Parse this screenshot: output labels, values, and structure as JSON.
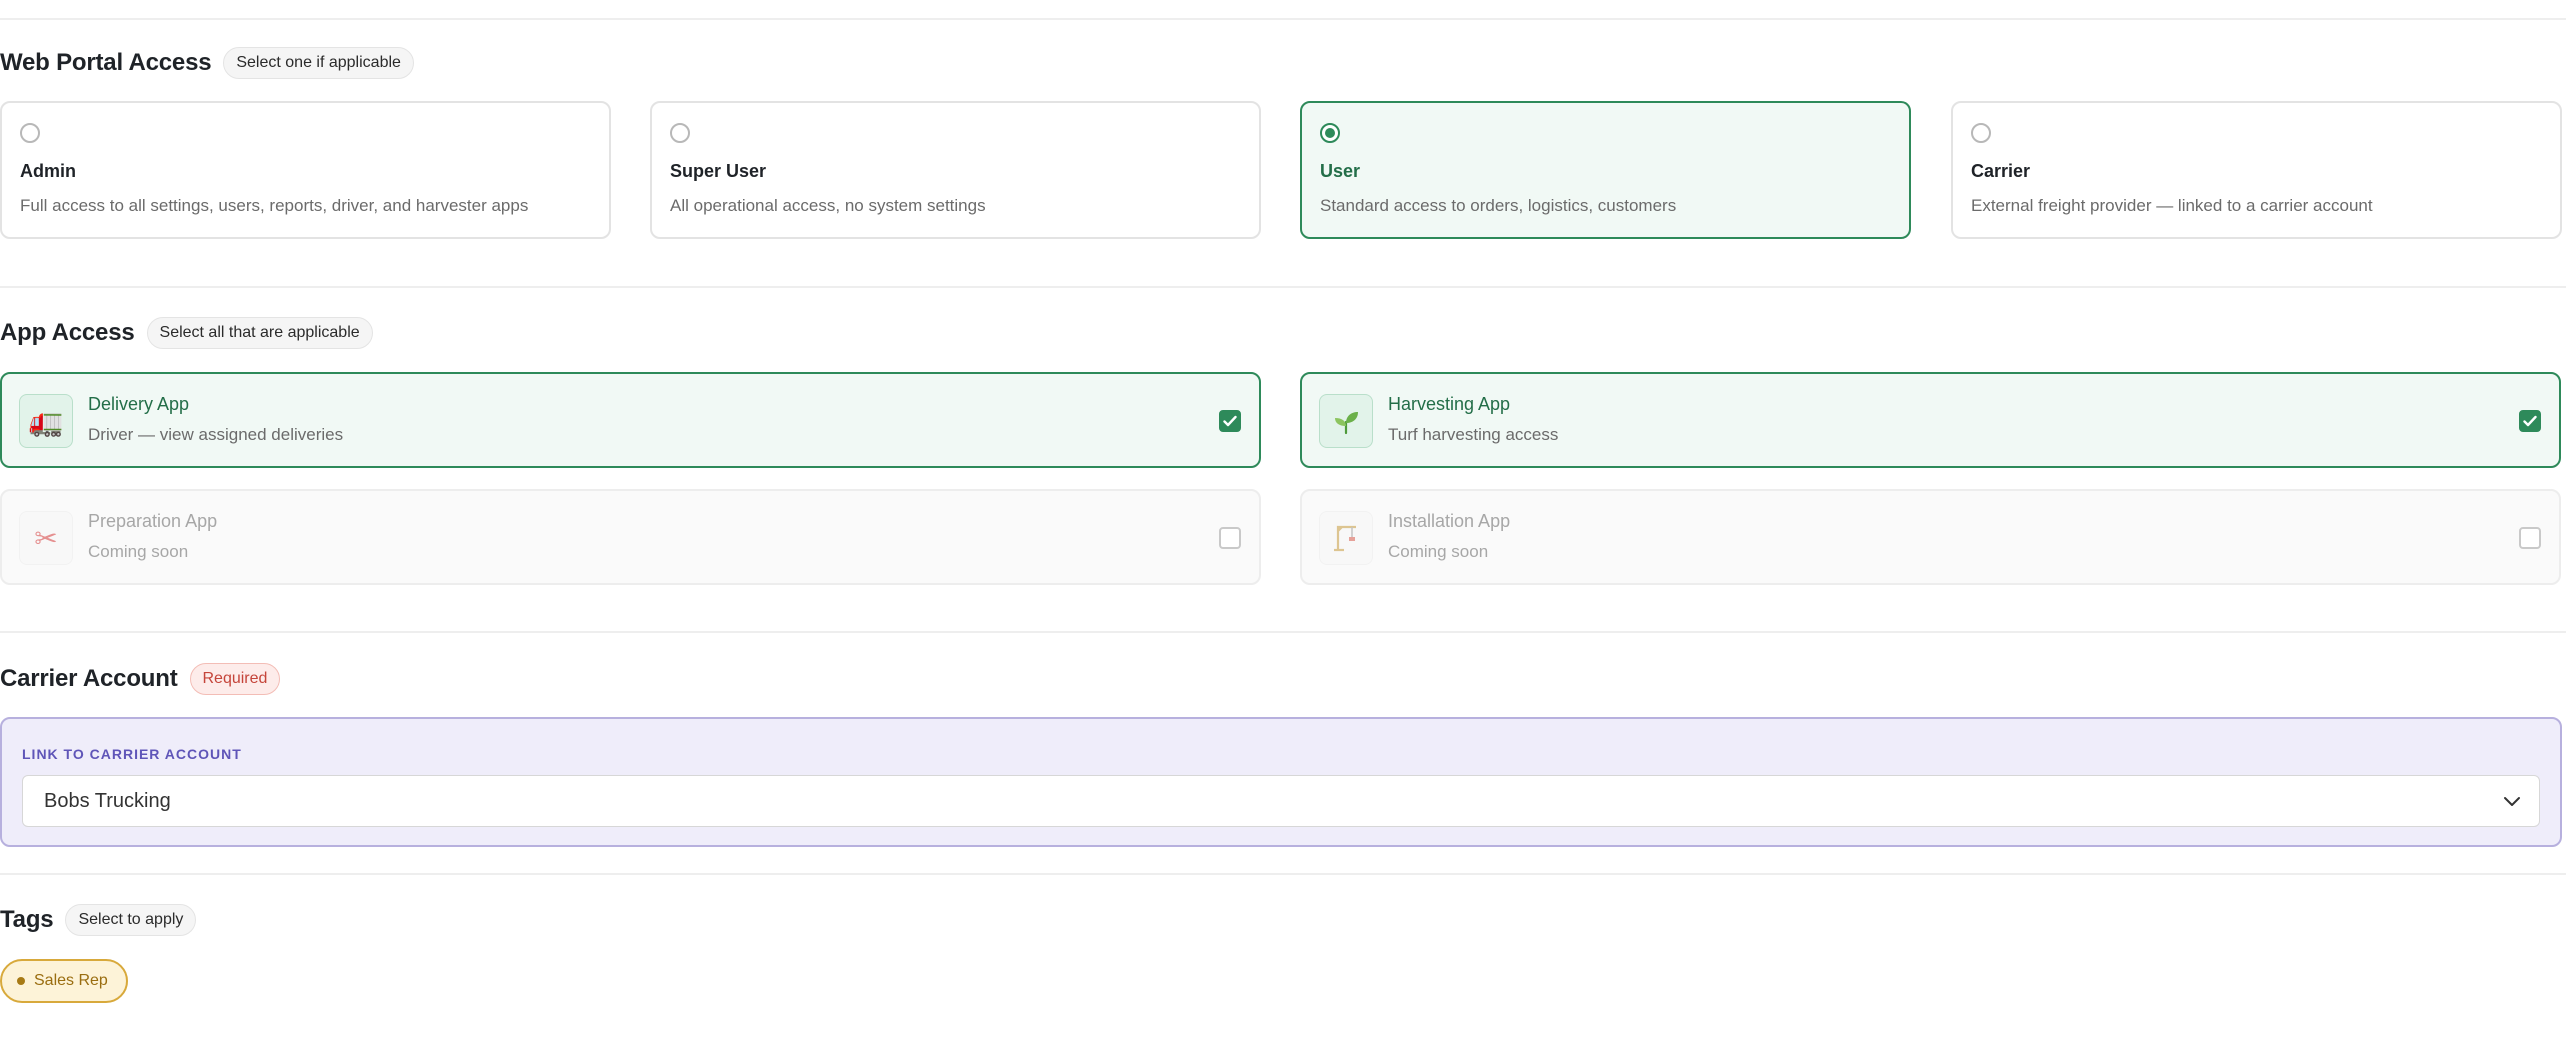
{
  "web_portal": {
    "title": "Web Portal Access",
    "hint": "Select one if applicable",
    "roles": [
      {
        "name": "Admin",
        "desc": "Full access to all settings, users, reports, driver, and harvester apps",
        "selected": false
      },
      {
        "name": "Super User",
        "desc": "All operational access, no system settings",
        "selected": false
      },
      {
        "name": "User",
        "desc": "Standard access to orders, logistics, customers",
        "selected": true
      },
      {
        "name": "Carrier",
        "desc": "External freight provider — linked to a carrier account",
        "selected": false
      }
    ]
  },
  "app_access": {
    "title": "App Access",
    "hint": "Select all that are applicable",
    "apps": [
      {
        "name": "Delivery App",
        "desc": "Driver — view assigned deliveries",
        "icon": "truck-icon",
        "checked": true,
        "disabled": false
      },
      {
        "name": "Harvesting App",
        "desc": "Turf harvesting access",
        "icon": "seedling-icon",
        "checked": true,
        "disabled": false
      },
      {
        "name": "Preparation App",
        "desc": "Coming soon",
        "icon": "scissors-icon",
        "checked": false,
        "disabled": true
      },
      {
        "name": "Installation App",
        "desc": "Coming soon",
        "icon": "crane-icon",
        "checked": false,
        "disabled": true
      }
    ]
  },
  "carrier_account": {
    "title": "Carrier Account",
    "badge": "Required",
    "field_label": "LINK TO CARRIER ACCOUNT",
    "selected_value": "Bobs Trucking"
  },
  "tags": {
    "title": "Tags",
    "hint": "Select to apply",
    "items": [
      {
        "label": "Sales Rep"
      }
    ]
  },
  "colors": {
    "accent_green": "#2e8a5a",
    "carrier_purple": "#5f55b8",
    "required_red": "#c5453a",
    "tag_gold": "#d8a93b"
  }
}
